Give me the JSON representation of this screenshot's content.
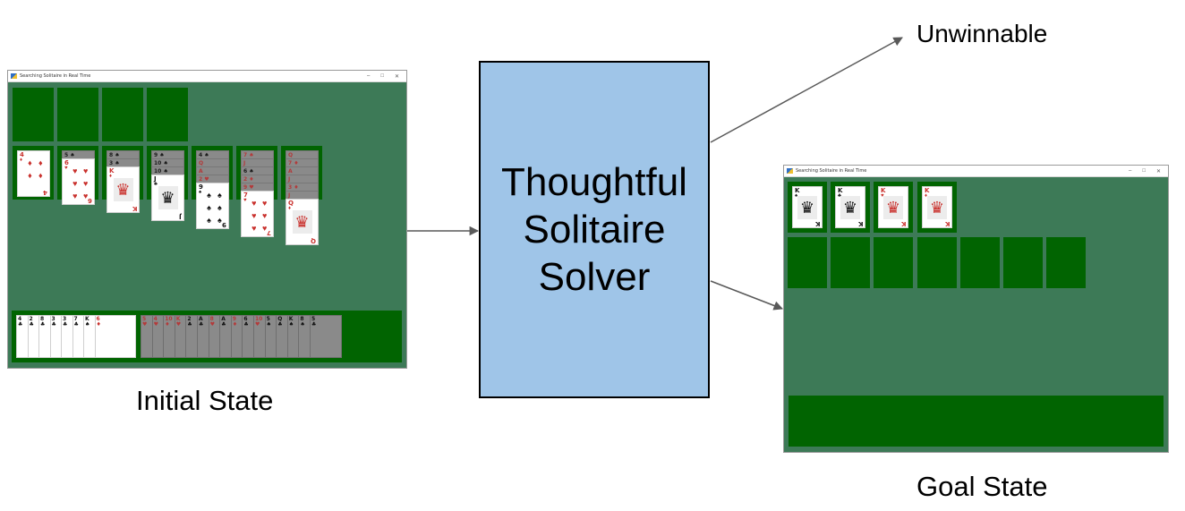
{
  "diagram": {
    "solver_label_lines": [
      "Thoughtful",
      "Solitaire",
      "Solver"
    ],
    "initial_label": "Initial State",
    "goal_label": "Goal State",
    "unwinnable_label": "Unwinnable",
    "colors": {
      "felt": "#3d7a57",
      "slot": "#016401",
      "solver_fill": "#9fc5e8",
      "arrow": "#595959",
      "red_suit": "#c9302c"
    },
    "edges": [
      {
        "from": "initial-state-window",
        "to": "solver-box"
      },
      {
        "from": "solver-box",
        "to": "unwinnable-label"
      },
      {
        "from": "solver-box",
        "to": "goal-state-window"
      }
    ]
  },
  "initial_window": {
    "title": "Searching Solitaire in Real Time",
    "controls": {
      "minimize": "–",
      "maximize": "□",
      "close": "✕"
    },
    "foundations": [
      null,
      null,
      null,
      null
    ],
    "tableau": [
      {
        "face_down": [],
        "face_up": {
          "rank": "4",
          "suit": "♦",
          "color": "red"
        }
      },
      {
        "face_down": [
          {
            "rank": "5",
            "suit": "♠"
          }
        ],
        "face_up": {
          "rank": "6",
          "suit": "♥",
          "color": "red"
        }
      },
      {
        "face_down": [
          {
            "rank": "8",
            "suit": "♠"
          },
          {
            "rank": "3",
            "suit": "♠"
          }
        ],
        "face_up": {
          "rank": "K",
          "suit": "♦",
          "color": "red",
          "face": true
        }
      },
      {
        "face_down": [
          {
            "rank": "9",
            "suit": "♠"
          },
          {
            "rank": "10",
            "suit": "♠"
          },
          {
            "rank": "10",
            "suit": "♠"
          }
        ],
        "face_up": {
          "rank": "J",
          "suit": "♣",
          "color": "black",
          "face": true
        }
      },
      {
        "face_down": [
          {
            "rank": "4",
            "suit": "♠"
          },
          {
            "rank": "Q",
            "suit": ""
          },
          {
            "rank": "A",
            "suit": ""
          },
          {
            "rank": "2",
            "suit": "♥"
          }
        ],
        "face_up": {
          "rank": "9",
          "suit": "♠",
          "color": "black"
        }
      },
      {
        "face_down": [
          {
            "rank": "7",
            "suit": "♠"
          },
          {
            "rank": "J",
            "suit": ""
          },
          {
            "rank": "6",
            "suit": "♠"
          },
          {
            "rank": "2",
            "suit": "♦"
          },
          {
            "rank": "9",
            "suit": "♥"
          }
        ],
        "face_up": {
          "rank": "7",
          "suit": "♥",
          "color": "red"
        }
      },
      {
        "face_down": [
          {
            "rank": "Q",
            "suit": ""
          },
          {
            "rank": "7",
            "suit": "♦"
          },
          {
            "rank": "A",
            "suit": ""
          },
          {
            "rank": "J",
            "suit": ""
          },
          {
            "rank": "3",
            "suit": "♦"
          },
          {
            "rank": "J",
            "suit": ""
          }
        ],
        "face_up": {
          "rank": "Q",
          "suit": "♦",
          "color": "red",
          "face": true
        }
      }
    ],
    "waste": [
      {
        "rank": "4",
        "suit": "♣",
        "color": "black"
      },
      {
        "rank": "2",
        "suit": "♣",
        "color": "black"
      },
      {
        "rank": "8",
        "suit": "♣",
        "color": "black"
      },
      {
        "rank": "3",
        "suit": "♣",
        "color": "black"
      },
      {
        "rank": "3",
        "suit": "♣",
        "color": "black"
      },
      {
        "rank": "7",
        "suit": "♣",
        "color": "black"
      },
      {
        "rank": "K",
        "suit": "♠",
        "color": "black"
      },
      {
        "rank": "6",
        "suit": "♦",
        "color": "red"
      }
    ],
    "stock": [
      {
        "rank": "5",
        "suit": "♥",
        "color": "red"
      },
      {
        "rank": "4",
        "suit": "♥",
        "color": "red"
      },
      {
        "rank": "10",
        "suit": "♦",
        "color": "red"
      },
      {
        "rank": "K",
        "suit": "♥",
        "color": "red"
      },
      {
        "rank": "2",
        "suit": "♣",
        "color": "black"
      },
      {
        "rank": "A",
        "suit": "♣",
        "color": "black"
      },
      {
        "rank": "8",
        "suit": "♥",
        "color": "red"
      },
      {
        "rank": "A",
        "suit": "♣",
        "color": "black"
      },
      {
        "rank": "9",
        "suit": "♦",
        "color": "red"
      },
      {
        "rank": "6",
        "suit": "♣",
        "color": "black"
      },
      {
        "rank": "10",
        "suit": "♥",
        "color": "red"
      },
      {
        "rank": "5",
        "suit": "♠",
        "color": "black"
      },
      {
        "rank": "Q",
        "suit": "♣",
        "color": "black"
      },
      {
        "rank": "K",
        "suit": "♠",
        "color": "black"
      },
      {
        "rank": "8",
        "suit": "♠",
        "color": "black"
      },
      {
        "rank": "5",
        "suit": "♣",
        "color": "black"
      }
    ]
  },
  "goal_window": {
    "title": "Searching Solitaire in Real Time",
    "controls": {
      "minimize": "–",
      "maximize": "□",
      "close": "✕"
    },
    "foundations": [
      {
        "rank": "K",
        "suit": "♠",
        "color": "black"
      },
      {
        "rank": "K",
        "suit": "♣",
        "color": "black"
      },
      {
        "rank": "K",
        "suit": "♥",
        "color": "red"
      },
      {
        "rank": "K",
        "suit": "♦",
        "color": "red"
      }
    ],
    "tableau_empty_count": 7,
    "stock_empty": true
  }
}
